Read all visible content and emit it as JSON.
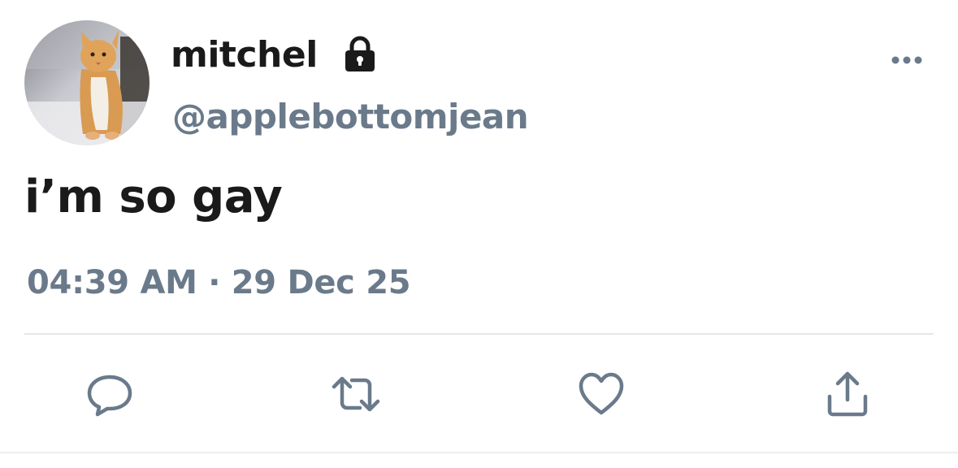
{
  "tweet": {
    "display_name": "mitchel",
    "handle": "@applebottomjean",
    "text": "i’m so gay",
    "timestamp": "04:39 AM · 29 Dec 25",
    "protected": true,
    "avatar_icon": "cat-avatar"
  },
  "icons": {
    "lock": "lock-icon",
    "more": "more-options-icon",
    "reply": "reply-icon",
    "retweet": "retweet-icon",
    "like": "like-icon",
    "share": "share-icon"
  },
  "colors": {
    "primary_text": "#1a1a1a",
    "secondary_text": "#6a7a8b",
    "icon": "#6a7a8b",
    "divider": "#e4e7ea"
  }
}
